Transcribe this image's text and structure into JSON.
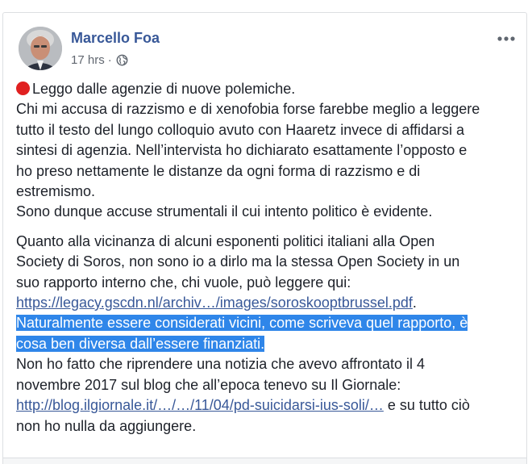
{
  "post": {
    "author": "Marcello Foa",
    "time": "17 hrs",
    "separator": "·",
    "privacy_icon": "globe-icon",
    "more_icon": "more-options-icon",
    "lines": {
      "l1": "Leggo dalle agenzie di nuove polemiche.",
      "l2": "Chi mi accusa di razzismo e di xenofobia forse farebbe meglio a leggere",
      "l3": "tutto il testo del lungo colloquio avuto con Haaretz invece di affidarsi a",
      "l4": "sintesi di agenzia. Nell’intervista ho dichiarato esattamente l’opposto e",
      "l5": "ho preso nettamente le distanze da ogni forma di razzismo e di",
      "l6": "estremismo.",
      "l7": "Sono dunque accuse strumentali il cui intento politico è evidente.",
      "l8": "Quanto alla vicinanza di alcuni esponenti politici italiani alla Open",
      "l9": "Society di Soros, non sono io a dirlo ma la stessa Open Society in un",
      "l10": "suo rapporto interno che, chi vuole, può leggere qui:",
      "l11_link": "https://legacy.gscdn.nl/archiv…/images/soroskooptbrussel.pdf",
      "l11_tail": ".",
      "l12_hl": "Naturalmente essere considerati vicini, come scriveva quel rapporto, è",
      "l13_hl": "cosa ben diversa dall’essere finanziati.",
      "l14": "Non ho fatto che riprendere una notizia che avevo affrontato il 4",
      "l15": "novembre 2017 sul blog che all’epoca tenevo su Il Giornale:",
      "l16_link": "http://blog.ilgiornale.it/…/…/11/04/pd-suicidarsi-ius-soli/…",
      "l16_tail": " e su tutto ciò",
      "l17": "non ho nulla da aggiungere."
    }
  },
  "colors": {
    "author": "#385898",
    "link": "#385898",
    "highlight": "#2f86e9",
    "meta": "#616770",
    "text": "#1d2129",
    "red_dot": "#e02020"
  }
}
